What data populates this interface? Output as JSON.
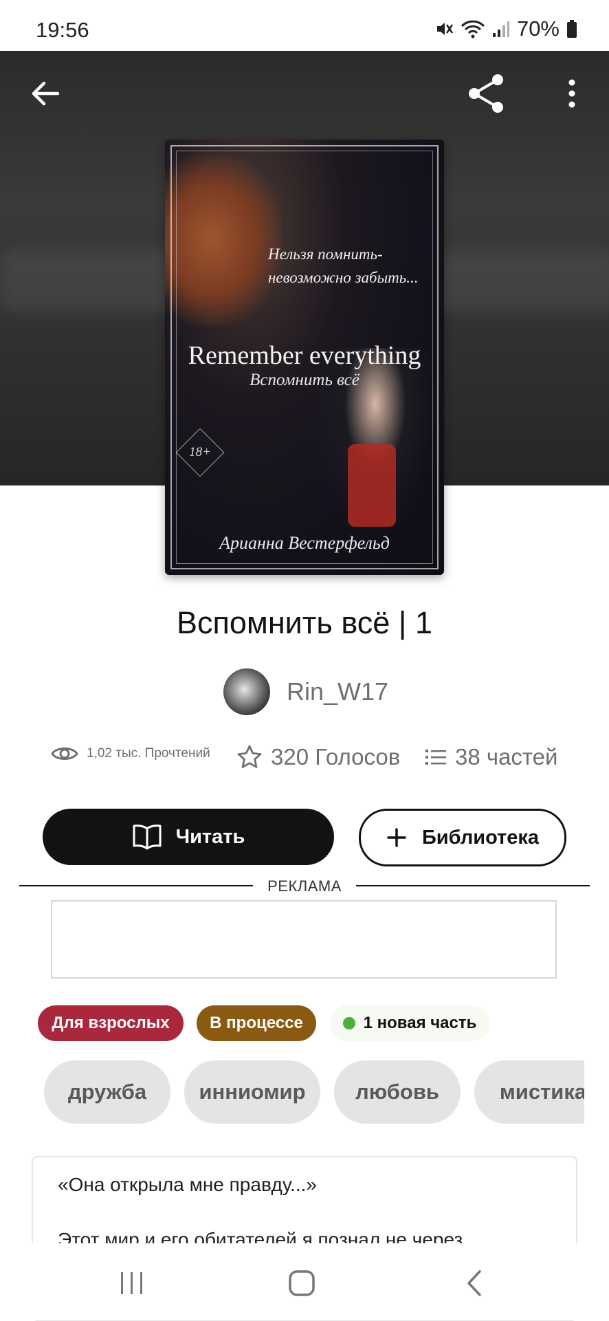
{
  "status": {
    "time": "19:56",
    "battery": "70%"
  },
  "cover": {
    "quote_line1": "Нельзя помнить-",
    "quote_line2": "невозможно забыть...",
    "title": "Remember everything",
    "subtitle": "Вспомнить всё",
    "age": "18+",
    "author": "Арианна Вестерфельд"
  },
  "story": {
    "title": "Вспомнить всё | 1",
    "author": "Rin_W17"
  },
  "stats": {
    "reads": "1,02 тыс. Прочтений",
    "votes": "320 Голосов",
    "parts": "38 частей"
  },
  "actions": {
    "read_label": "Читать",
    "library_label": "Библиотека"
  },
  "ad": {
    "label": "РЕКЛАМА"
  },
  "badges": {
    "mature": "Для взрослых",
    "ongoing": "В процессе",
    "new_part": "1 новая часть"
  },
  "tags": [
    "дружба",
    "инниомир",
    "любовь",
    "мистика"
  ],
  "description": {
    "line1": "«Она открыла мне правду...»",
    "line2": "Этот мир и его обитателей я познал не через"
  },
  "colors": {
    "mature_badge": "#a9283e",
    "ongoing_badge": "#8a5a12",
    "new_dot": "#4caf3a",
    "primary_button": "#121212"
  },
  "icons": {
    "back": "arrow-left-icon",
    "share": "share-icon",
    "more": "more-vertical-icon",
    "reads": "eye-icon",
    "votes": "star-icon",
    "parts": "list-icon",
    "read": "book-icon",
    "library": "plus-icon"
  }
}
